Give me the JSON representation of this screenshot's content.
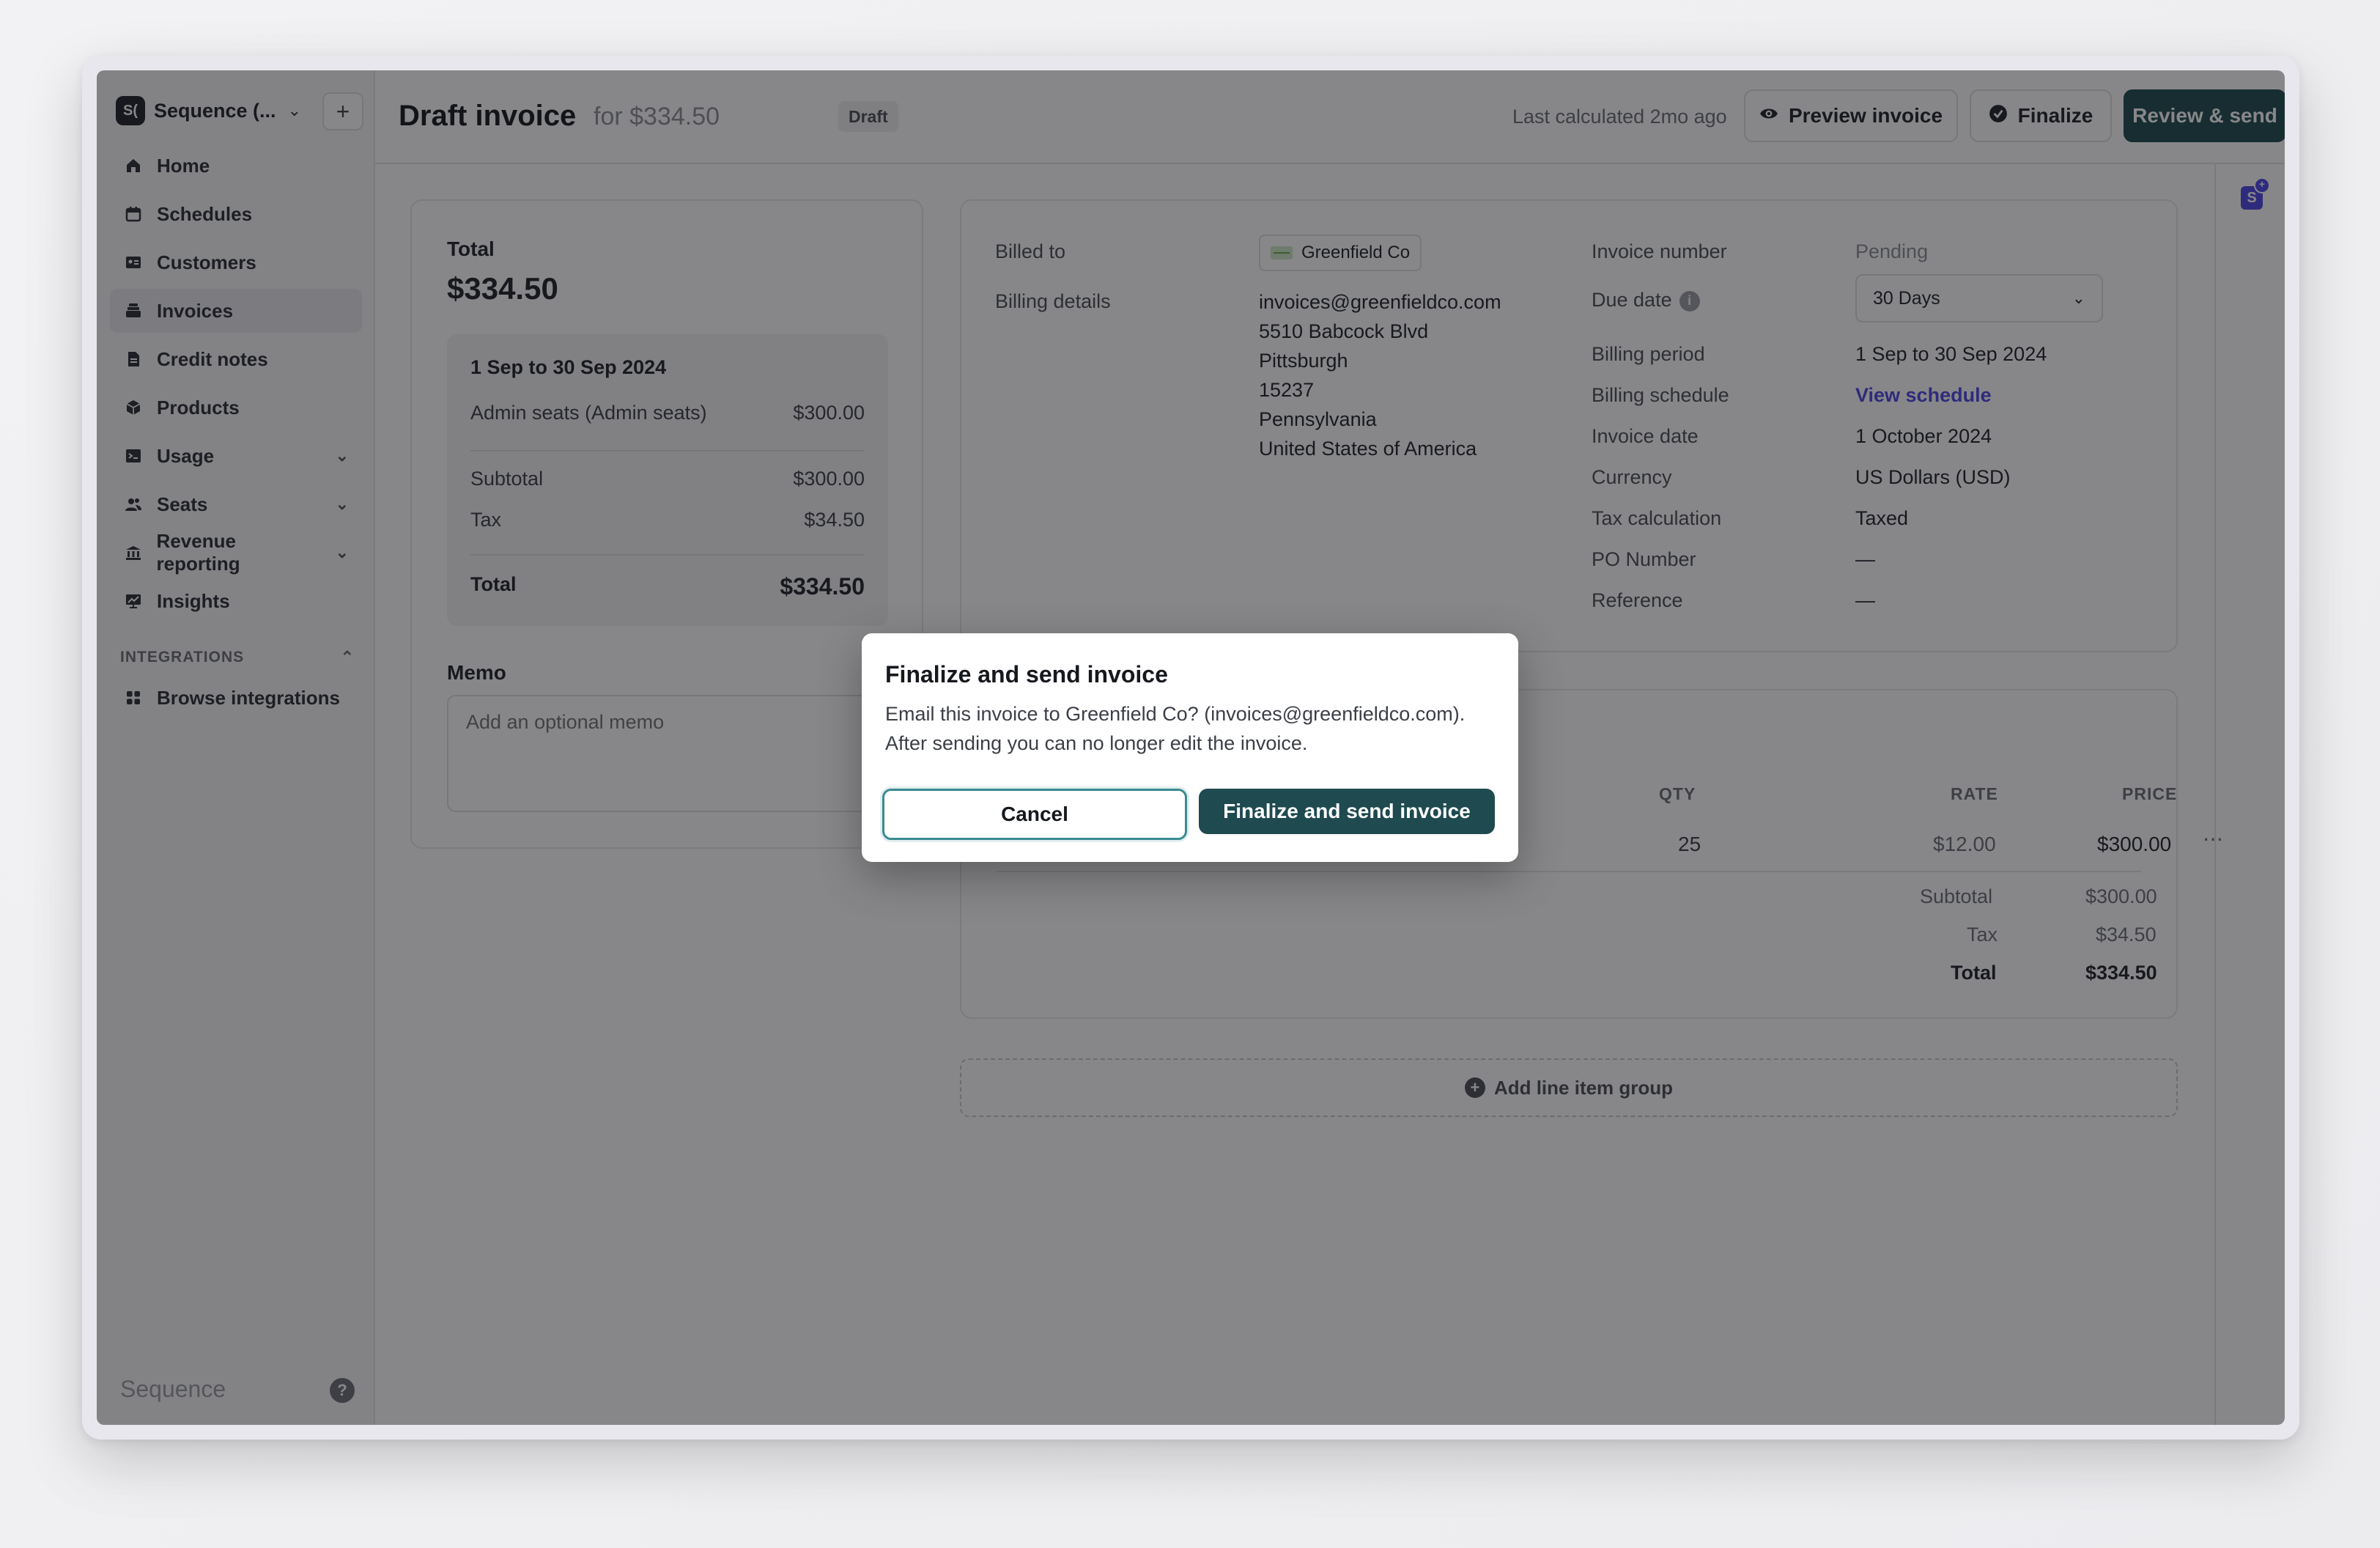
{
  "sidebar": {
    "workspace": {
      "avatar": "S(",
      "name": "Sequence (..."
    },
    "items": [
      {
        "label": "Home"
      },
      {
        "label": "Schedules"
      },
      {
        "label": "Customers"
      },
      {
        "label": "Invoices",
        "active": true
      },
      {
        "label": "Credit notes"
      },
      {
        "label": "Products"
      },
      {
        "label": "Usage"
      },
      {
        "label": "Seats"
      },
      {
        "label": "Revenue reporting"
      },
      {
        "label": "Insights"
      }
    ],
    "section_label": "INTEGRATIONS",
    "integrations": [
      {
        "label": "Browse integrations"
      }
    ],
    "footer_brand": "Sequence",
    "help": "?"
  },
  "header": {
    "title": "Draft invoice",
    "subtitle": "for $334.50",
    "badge": "Draft",
    "last_calculated": "Last calculated 2mo ago",
    "preview_label": "Preview invoice",
    "finalize_label": "Finalize",
    "review_label": "Review & send",
    "more": "⋯"
  },
  "total_card": {
    "label": "Total",
    "amount": "$334.50",
    "period": "1 Sep to 30 Sep 2024",
    "line_label": "Admin seats (Admin seats)",
    "line_amount": "$300.00",
    "subtotal_label": "Subtotal",
    "subtotal": "$300.00",
    "tax_label": "Tax",
    "tax": "$34.50",
    "total_label": "Total",
    "total": "$334.50",
    "memo_label": "Memo",
    "memo_placeholder": "Add an optional memo"
  },
  "details": {
    "billed_to_label": "Billed to",
    "customer": "Greenfield Co",
    "billing_details_label": "Billing details",
    "address": {
      "email": "invoices@greenfieldco.com",
      "street": "5510 Babcock Blvd",
      "city": "Pittsburgh",
      "zip": "15237",
      "state": "Pennsylvania",
      "country": "United States of America"
    },
    "invoice_number_label": "Invoice number",
    "invoice_number": "Pending",
    "due_date_label": "Due date",
    "due_date": "30 Days",
    "billing_period_label": "Billing period",
    "billing_period": "1 Sep to 30 Sep 2024",
    "billing_schedule_label": "Billing schedule",
    "billing_schedule": "View schedule",
    "invoice_date_label": "Invoice date",
    "invoice_date": "1 October 2024",
    "currency_label": "Currency",
    "currency": "US Dollars (USD)",
    "tax_calc_label": "Tax calculation",
    "tax_calc": "Taxed",
    "po_label": "PO Number",
    "po": "—",
    "reference_label": "Reference",
    "reference": "—"
  },
  "items": {
    "columns": {
      "qty": "QTY",
      "rate": "RATE",
      "price": "PRICE"
    },
    "row": {
      "qty": "25",
      "rate": "$12.00",
      "price": "$300.00",
      "more": "⋯"
    },
    "subtotal_label": "Subtotal",
    "subtotal": "$300.00",
    "tax_label": "Tax",
    "tax": "$34.50",
    "total_label": "Total",
    "total": "$334.50",
    "add_group_label": "Add line item group"
  },
  "modal": {
    "title": "Finalize and send invoice",
    "body_line1": "Email this invoice to Greenfield Co? (invoices@greenfieldco.com).",
    "body_line2": "After sending you can no longer edit the invoice.",
    "cancel_label": "Cancel",
    "confirm_label": "Finalize and send invoice"
  },
  "colors": {
    "primary": "#1f4a4f",
    "link": "#4f46e5",
    "focus": "#3a8a92"
  }
}
